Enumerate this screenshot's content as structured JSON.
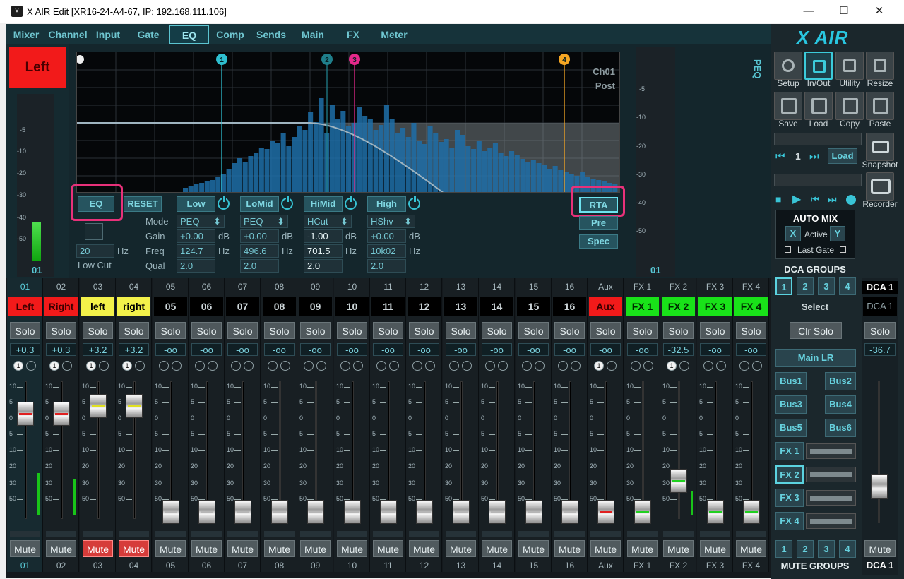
{
  "window": {
    "title": "X AIR Edit [XR16-24-A4-67, IP: 192.168.111.106]",
    "app_icon": "xair-app-icon",
    "controls": [
      "—",
      "☐",
      "✕"
    ]
  },
  "tabs": [
    "Mixer",
    "Channel",
    "Input",
    "Gate",
    "EQ",
    "Comp",
    "Sends",
    "Main",
    "FX",
    "Meter"
  ],
  "active_tab": "EQ",
  "channel": {
    "name": "Left",
    "number": "01",
    "meter_scale": [
      "-5",
      "-10",
      "-20",
      "-30",
      "-40",
      "-50"
    ],
    "meter_level": 0.46
  },
  "graph": {
    "label1": "Ch01",
    "label2": "Post",
    "band_markers": [
      "1",
      "2",
      "3",
      "4"
    ],
    "band_colors": [
      "#2ebfd0",
      "#1f7e8a",
      "#e5288a",
      "#f5a623"
    ]
  },
  "eq": {
    "eq_button": "EQ",
    "reset_button": "RESET",
    "low_cut_freq": "20",
    "low_cut_unit": "Hz",
    "low_cut_label": "Low Cut",
    "row_labels": [
      "Mode",
      "Gain",
      "Freq",
      "Qual"
    ],
    "units": {
      "gain": "dB",
      "freq": "Hz"
    },
    "bands": [
      {
        "name": "Low",
        "mode": "PEQ",
        "gain": "+0.00",
        "freq": "124.7",
        "qual": "2.0"
      },
      {
        "name": "LoMid",
        "mode": "PEQ",
        "gain": "+0.00",
        "freq": "496.6",
        "qual": "2.0"
      },
      {
        "name": "HiMid",
        "mode": "HCut",
        "gain": "-1.00",
        "freq": "701.5",
        "qual": "2.0"
      },
      {
        "name": "High",
        "mode": "HShv",
        "gain": "+0.00",
        "freq": "10k02",
        "qual": "2.0"
      }
    ],
    "rta_button": "RTA",
    "pre_button": "Pre",
    "spec_button": "Spec"
  },
  "right_meter": {
    "scale": [
      "-5",
      "-10",
      "-20",
      "-30",
      "-40",
      "-50"
    ],
    "number": "01"
  },
  "peq_tab": "PEQ",
  "sidebar": {
    "logo": "X AIR",
    "row1": [
      {
        "label": "Setup",
        "icon": "gear-icon"
      },
      {
        "label": "In/Out",
        "icon": "in-out-icon"
      },
      {
        "label": "Utility",
        "icon": "wrench-icon"
      },
      {
        "label": "Resize",
        "icon": "resize-icon"
      }
    ],
    "row2": [
      {
        "label": "Save",
        "icon": "save-icon"
      },
      {
        "label": "Load",
        "icon": "folder-icon"
      },
      {
        "label": "Copy",
        "icon": "copy-icon"
      },
      {
        "label": "Paste",
        "icon": "paste-icon"
      }
    ],
    "snapshot_number": "1",
    "snapshot_load": "Load",
    "snapshot_label": "Snapshot",
    "recorder_label": "Recorder",
    "automix": {
      "title": "AUTO MIX",
      "x": "X",
      "active": "Active",
      "y": "Y",
      "last_gate": "Last Gate"
    },
    "dca_groups_title": "DCA GROUPS",
    "dca_buttons": [
      "1",
      "2",
      "3",
      "4"
    ],
    "select_label": "Select",
    "clr_solo": "Clr Solo",
    "main_lr": "Main LR",
    "bus_buttons": [
      "Bus1",
      "Bus2",
      "Bus3",
      "Bus4",
      "Bus5",
      "Bus6"
    ],
    "fx_buttons": [
      "FX 1",
      "FX 2",
      "FX 3",
      "FX 4"
    ],
    "mute_buttons": [
      "1",
      "2",
      "3",
      "4"
    ],
    "mute_groups_title": "MUTE GROUPS"
  },
  "strips": [
    {
      "head": "01",
      "name": "Left",
      "color": "#f21a1a",
      "text_color": "#3b0000",
      "gain": "+0.3",
      "mute_on": false,
      "group": "1",
      "fader": 0.72
    },
    {
      "head": "02",
      "name": "Right",
      "color": "#f21a1a",
      "text_color": "#3b0000",
      "gain": "+0.3",
      "mute_on": false,
      "group": "1",
      "fader": 0.72
    },
    {
      "head": "03",
      "name": "left",
      "color": "#f3f14a",
      "text_color": "#000",
      "gain": "+3.2",
      "mute_on": true,
      "group": "1",
      "fader": 0.78
    },
    {
      "head": "04",
      "name": "right",
      "color": "#f3f14a",
      "text_color": "#000",
      "gain": "+3.2",
      "mute_on": true,
      "group": "1",
      "fader": 0.78
    },
    {
      "head": "05",
      "name": "05",
      "color": "#000",
      "text_color": "#cdd6d9",
      "gain": "-oo",
      "mute_on": false,
      "group": "",
      "fader": 0.0
    },
    {
      "head": "06",
      "name": "06",
      "color": "#000",
      "text_color": "#cdd6d9",
      "gain": "-oo",
      "mute_on": false,
      "group": "",
      "fader": 0.0
    },
    {
      "head": "07",
      "name": "07",
      "color": "#000",
      "text_color": "#cdd6d9",
      "gain": "-oo",
      "mute_on": false,
      "group": "",
      "fader": 0.0
    },
    {
      "head": "08",
      "name": "08",
      "color": "#000",
      "text_color": "#cdd6d9",
      "gain": "-oo",
      "mute_on": false,
      "group": "",
      "fader": 0.0
    },
    {
      "head": "09",
      "name": "09",
      "color": "#000",
      "text_color": "#cdd6d9",
      "gain": "-oo",
      "mute_on": false,
      "group": "",
      "fader": 0.0
    },
    {
      "head": "10",
      "name": "10",
      "color": "#000",
      "text_color": "#cdd6d9",
      "gain": "-oo",
      "mute_on": false,
      "group": "",
      "fader": 0.0
    },
    {
      "head": "11",
      "name": "11",
      "color": "#000",
      "text_color": "#cdd6d9",
      "gain": "-oo",
      "mute_on": false,
      "group": "",
      "fader": 0.0
    },
    {
      "head": "12",
      "name": "12",
      "color": "#000",
      "text_color": "#cdd6d9",
      "gain": "-oo",
      "mute_on": false,
      "group": "",
      "fader": 0.0
    },
    {
      "head": "13",
      "name": "13",
      "color": "#000",
      "text_color": "#cdd6d9",
      "gain": "-oo",
      "mute_on": false,
      "group": "",
      "fader": 0.0
    },
    {
      "head": "14",
      "name": "14",
      "color": "#000",
      "text_color": "#cdd6d9",
      "gain": "-oo",
      "mute_on": false,
      "group": "",
      "fader": 0.0
    },
    {
      "head": "15",
      "name": "15",
      "color": "#000",
      "text_color": "#cdd6d9",
      "gain": "-oo",
      "mute_on": false,
      "group": "",
      "fader": 0.0
    },
    {
      "head": "16",
      "name": "16",
      "color": "#000",
      "text_color": "#cdd6d9",
      "gain": "-oo",
      "mute_on": false,
      "group": "",
      "fader": 0.0
    },
    {
      "head": "Aux",
      "name": "Aux",
      "color": "#f21a1a",
      "text_color": "#3b0000",
      "gain": "-oo",
      "mute_on": false,
      "group": "1",
      "fader": 0.0
    },
    {
      "head": "FX 1",
      "name": "FX 1",
      "color": "#19e219",
      "text_color": "#002800",
      "gain": "-oo",
      "mute_on": false,
      "group": "",
      "fader": 0.0
    },
    {
      "head": "FX 2",
      "name": "FX 2",
      "color": "#19e219",
      "text_color": "#002800",
      "gain": "-32.5",
      "mute_on": false,
      "group": "1",
      "fader": 0.22
    },
    {
      "head": "FX 3",
      "name": "FX 3",
      "color": "#19e219",
      "text_color": "#002800",
      "gain": "-oo",
      "mute_on": false,
      "group": "",
      "fader": 0.0
    },
    {
      "head": "FX 4",
      "name": "FX 4",
      "color": "#19e219",
      "text_color": "#002800",
      "gain": "-oo",
      "mute_on": false,
      "group": "",
      "fader": 0.0
    }
  ],
  "strip_labels": {
    "solo": "Solo",
    "mute": "Mute"
  },
  "fader_scale": [
    "10",
    "5",
    "0",
    "5",
    "10",
    "20",
    "30",
    "50"
  ],
  "dca": {
    "head": "DCA 1",
    "name": "DCA 1",
    "gain": "-36.7",
    "solo": "Solo",
    "mute": "Mute",
    "foot": "DCA 1",
    "fader": 0.25
  }
}
